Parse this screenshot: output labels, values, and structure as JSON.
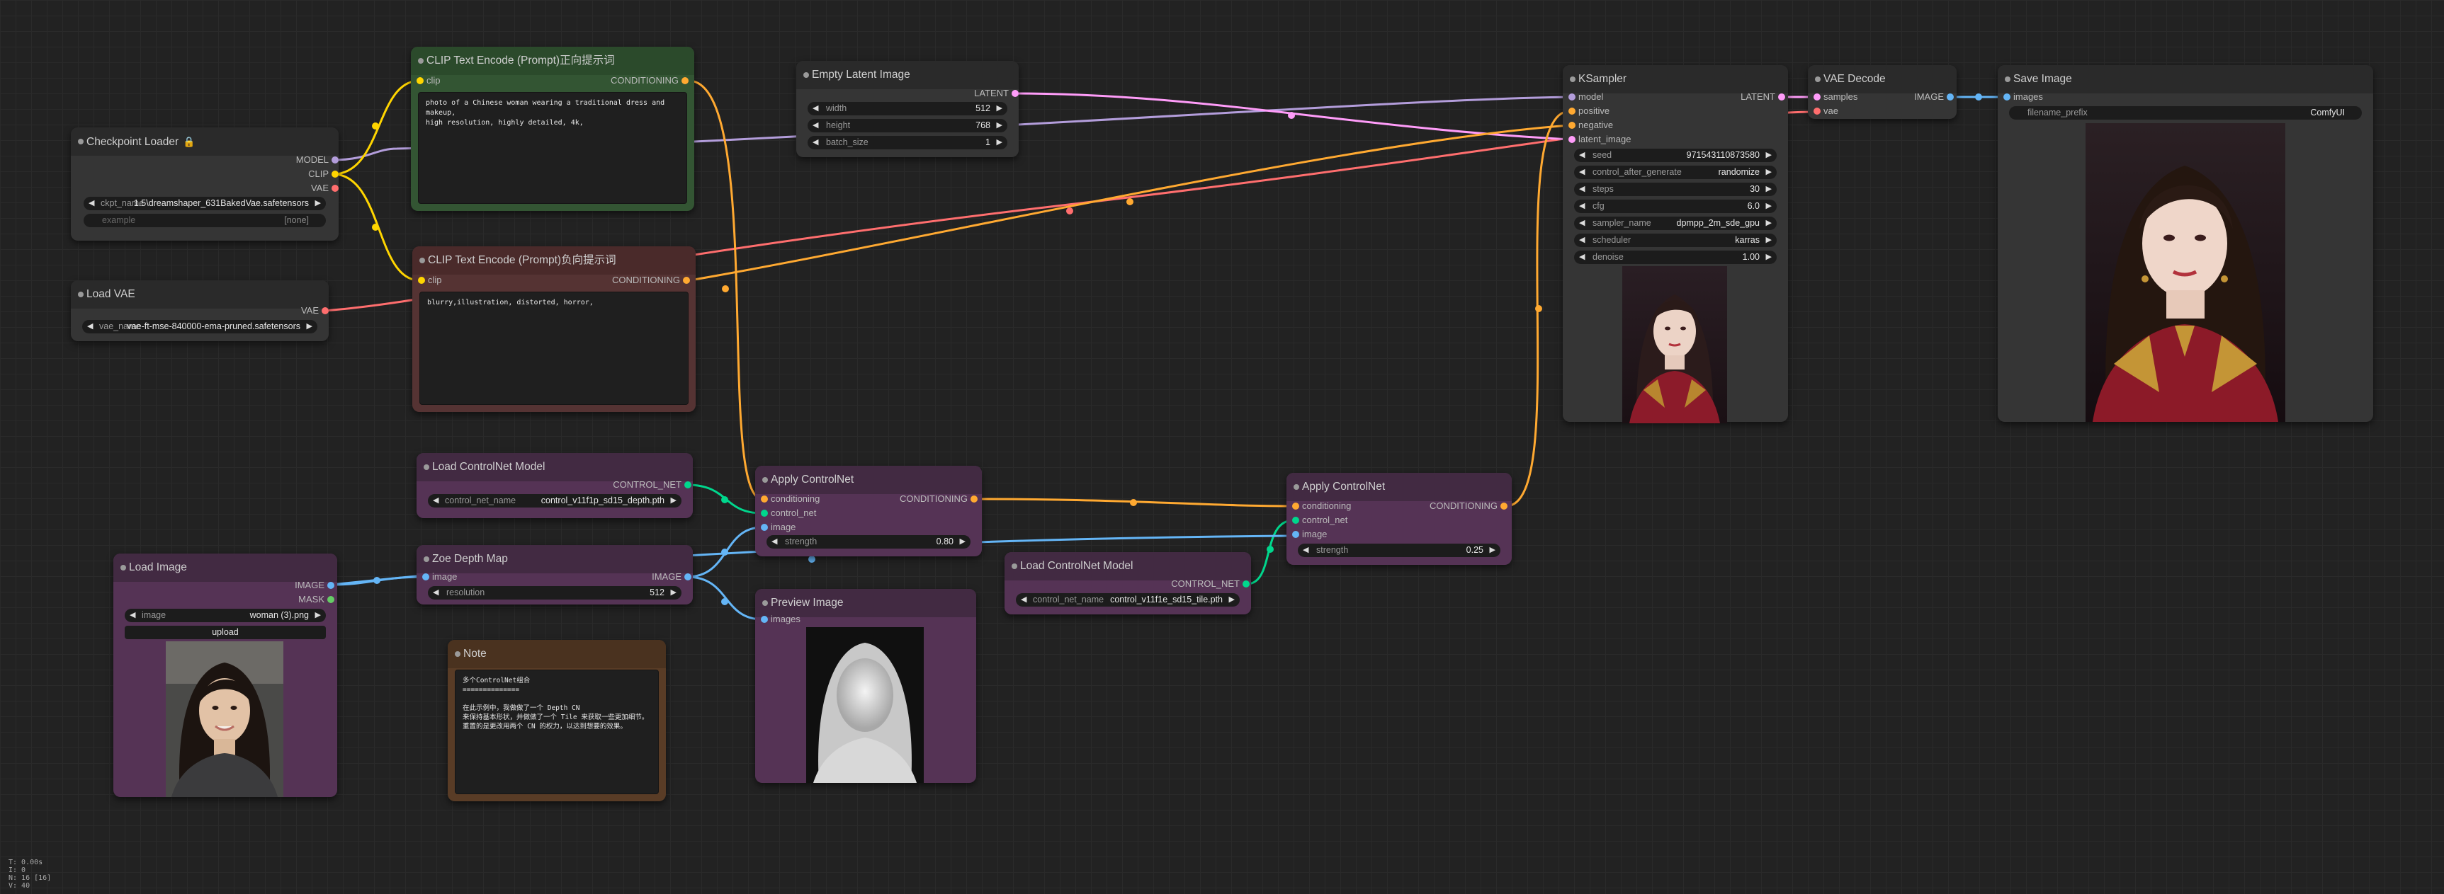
{
  "colors": {
    "clip": "#ffd500",
    "model": "#b39ddb",
    "vae": "#ff6e6e",
    "latent": "#ff9cf9",
    "conditioning": "#ffa931",
    "control_net": "#00d78d",
    "image": "#64b5f6"
  },
  "nodes": {
    "checkpoint_loader": {
      "title": "Checkpoint Loader",
      "outputs": [
        "MODEL",
        "CLIP",
        "VAE"
      ],
      "ckpt_label": "ckpt_name",
      "ckpt_value": "1.5\\dreamshaper_631BakedVae.safetensors",
      "example_label": "example",
      "example_value": "[none]"
    },
    "load_vae": {
      "title": "Load VAE",
      "output": "VAE",
      "vae_label": "vae_name",
      "vae_value": "vae-ft-mse-840000-ema-pruned.safetensors"
    },
    "clip_pos": {
      "title": "CLIP Text Encode (Prompt)正向提示词",
      "input": "clip",
      "output": "CONDITIONING",
      "text": "photo of a Chinese woman wearing a traditional dress and makeup,\nhigh resolution, highly detailed, 4k,"
    },
    "clip_neg": {
      "title": "CLIP Text Encode (Prompt)负向提示词",
      "input": "clip",
      "output": "CONDITIONING",
      "text": "blurry,illustration, distorted, horror,"
    },
    "empty_latent": {
      "title": "Empty Latent Image",
      "output": "LATENT",
      "width_label": "width",
      "width_value": "512",
      "height_label": "height",
      "height_value": "768",
      "batch_label": "batch_size",
      "batch_value": "1"
    },
    "ksampler": {
      "title": "KSampler",
      "inputs": [
        "model",
        "positive",
        "negative",
        "latent_image"
      ],
      "output": "LATENT",
      "widgets": [
        {
          "label": "seed",
          "value": "971543110873580"
        },
        {
          "label": "control_after_generate",
          "value": "randomize"
        },
        {
          "label": "steps",
          "value": "30"
        },
        {
          "label": "cfg",
          "value": "6.0"
        },
        {
          "label": "sampler_name",
          "value": "dpmpp_2m_sde_gpu"
        },
        {
          "label": "scheduler",
          "value": "karras"
        },
        {
          "label": "denoise",
          "value": "1.00"
        }
      ]
    },
    "vae_decode": {
      "title": "VAE Decode",
      "inputs": [
        "samples",
        "vae"
      ],
      "output": "IMAGE"
    },
    "save_image": {
      "title": "Save Image",
      "input": "images",
      "prefix_label": "filename_prefix",
      "prefix_value": "ComfyUI"
    },
    "load_cn_1": {
      "title": "Load ControlNet Model",
      "output": "CONTROL_NET",
      "label": "control_net_name",
      "value": "control_v11f1p_sd15_depth.pth"
    },
    "apply_cn_1": {
      "title": "Apply ControlNet",
      "inputs": [
        "conditioning",
        "control_net",
        "image"
      ],
      "output": "CONDITIONING",
      "strength_label": "strength",
      "strength_value": "0.80"
    },
    "load_image": {
      "title": "Load Image",
      "outputs": [
        "IMAGE",
        "MASK"
      ],
      "image_label": "image",
      "image_value": "woman (3).png",
      "upload_label": "upload"
    },
    "zoe_depth": {
      "title": "Zoe Depth Map",
      "input": "image",
      "output": "IMAGE",
      "res_label": "resolution",
      "res_value": "512"
    },
    "preview_image": {
      "title": "Preview Image",
      "input": "images"
    },
    "note": {
      "title": "Note",
      "text": "多个ControlNet组合\n==============\n\n在此示例中，我做做了一个 Depth CN\n来保持基本形状，并做做了一个 Tile 来获取一些更加细节。\n重置的是更改用两个 CN 的权力，以达到想要的效果。"
    },
    "load_cn_2": {
      "title": "Load ControlNet Model",
      "output": "CONTROL_NET",
      "label": "control_net_name",
      "value": "control_v11f1e_sd15_tile.pth"
    },
    "apply_cn_2": {
      "title": "Apply ControlNet",
      "inputs": [
        "conditioning",
        "control_net",
        "image"
      ],
      "output": "CONDITIONING",
      "strength_label": "strength",
      "strength_value": "0.25"
    }
  },
  "status": "T: 0.00s\nI: 0\nN: 16 [16]\nV: 40"
}
